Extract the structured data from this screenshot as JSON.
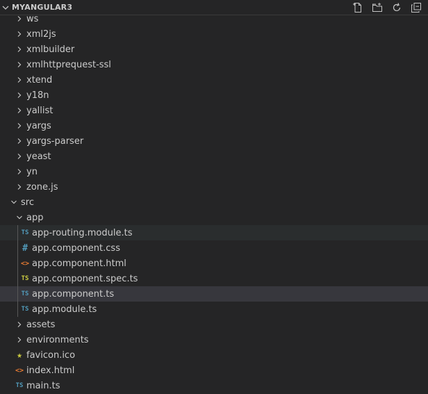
{
  "header": {
    "title": "MYANGULAR3",
    "chevron_icon": "chevron-down-icon",
    "actions": [
      "new-file-icon",
      "new-folder-icon",
      "refresh-icon",
      "collapse-all-icon"
    ]
  },
  "colors": {
    "background": "#252526",
    "selected": "#37373d",
    "hover": "#2a2d2e",
    "text": "#cccccc",
    "ts_blue": "#519aba",
    "ts_yellow": "#cbcb41",
    "html_orange": "#e37933",
    "css_blue": "#519aba",
    "star_yellow": "#cbcb41"
  },
  "tree": {
    "items": [
      {
        "label": "ws",
        "type": "folder",
        "level": 1,
        "expanded": false
      },
      {
        "label": "xml2js",
        "type": "folder",
        "level": 1,
        "expanded": false
      },
      {
        "label": "xmlbuilder",
        "type": "folder",
        "level": 1,
        "expanded": false
      },
      {
        "label": "xmlhttprequest-ssl",
        "type": "folder",
        "level": 1,
        "expanded": false
      },
      {
        "label": "xtend",
        "type": "folder",
        "level": 1,
        "expanded": false
      },
      {
        "label": "y18n",
        "type": "folder",
        "level": 1,
        "expanded": false
      },
      {
        "label": "yallist",
        "type": "folder",
        "level": 1,
        "expanded": false
      },
      {
        "label": "yargs",
        "type": "folder",
        "level": 1,
        "expanded": false
      },
      {
        "label": "yargs-parser",
        "type": "folder",
        "level": 1,
        "expanded": false
      },
      {
        "label": "yeast",
        "type": "folder",
        "level": 1,
        "expanded": false
      },
      {
        "label": "yn",
        "type": "folder",
        "level": 1,
        "expanded": false
      },
      {
        "label": "zone.js",
        "type": "folder",
        "level": 1,
        "expanded": false
      },
      {
        "label": "src",
        "type": "folder",
        "level": 0,
        "expanded": true
      },
      {
        "label": "app",
        "type": "folder",
        "level": 1,
        "expanded": true
      },
      {
        "label": "app-routing.module.ts",
        "type": "file",
        "icon": "TS",
        "icon_name": "typescript-icon",
        "level": 2,
        "state": "hover"
      },
      {
        "label": "app.component.css",
        "type": "file",
        "icon": "#",
        "icon_name": "css-icon",
        "level": 2
      },
      {
        "label": "app.component.html",
        "type": "file",
        "icon": "<>",
        "icon_name": "html-icon",
        "level": 2
      },
      {
        "label": "app.component.spec.ts",
        "type": "file",
        "icon": "TS",
        "icon_name": "typescript-spec-icon",
        "level": 2
      },
      {
        "label": "app.component.ts",
        "type": "file",
        "icon": "TS",
        "icon_name": "typescript-icon",
        "level": 2,
        "state": "selected"
      },
      {
        "label": "app.module.ts",
        "type": "file",
        "icon": "TS",
        "icon_name": "typescript-icon",
        "level": 2
      },
      {
        "label": "assets",
        "type": "folder",
        "level": 1,
        "expanded": false
      },
      {
        "label": "environments",
        "type": "folder",
        "level": 1,
        "expanded": false
      },
      {
        "label": "favicon.ico",
        "type": "file",
        "icon": "★",
        "icon_name": "star-icon",
        "level": 1
      },
      {
        "label": "index.html",
        "type": "file",
        "icon": "<>",
        "icon_name": "html-icon",
        "level": 1
      },
      {
        "label": "main.ts",
        "type": "file",
        "icon": "TS",
        "icon_name": "typescript-icon",
        "level": 1
      }
    ]
  }
}
